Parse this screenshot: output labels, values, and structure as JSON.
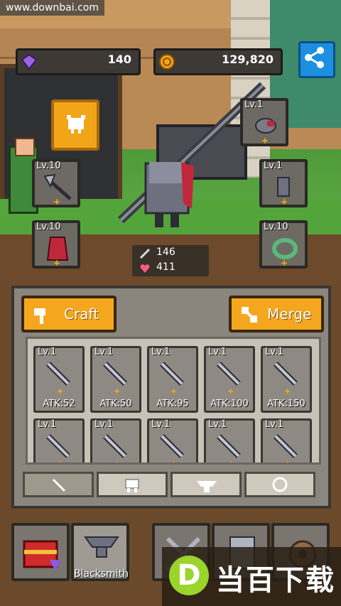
{
  "watermark": "www.downbai.com",
  "currency": {
    "gems": "140",
    "coins": "129,820",
    "gem_icon": "purple-gem-icon",
    "coin_icon": "gold-coin-icon",
    "share_icon": "share-icon"
  },
  "equipment": {
    "slots": [
      {
        "id": "helmet",
        "level": "Lv.1",
        "icon": "helmet-icon"
      },
      {
        "id": "weapon",
        "level": "Lv.10",
        "icon": "axe-icon"
      },
      {
        "id": "glove",
        "level": "Lv.1",
        "icon": "gauntlet-icon"
      },
      {
        "id": "armor",
        "level": "Lv.10",
        "icon": "armor-icon"
      },
      {
        "id": "ring",
        "level": "Lv.10",
        "icon": "ring-icon"
      }
    ],
    "pet_button_icon": "pet-icon"
  },
  "hero_stats": {
    "attack": "146",
    "health": "411",
    "attack_icon": "sword-icon",
    "health_icon": "heart-icon"
  },
  "panel": {
    "craft_label": "Craft",
    "merge_label": "Merge",
    "items": [
      {
        "level": "Lv.1",
        "atk": "ATK:52",
        "icon": "sword-icon"
      },
      {
        "level": "Lv.1",
        "atk": "ATK:50",
        "icon": "sword-icon"
      },
      {
        "level": "Lv.1",
        "atk": "ATK:95",
        "icon": "sword-icon"
      },
      {
        "level": "Lv.1",
        "atk": "ATK:100",
        "icon": "sword-icon"
      },
      {
        "level": "Lv.1",
        "atk": "ATK:150",
        "icon": "sword-icon"
      },
      {
        "level": "Lv.1",
        "atk": "",
        "icon": "sword-icon"
      },
      {
        "level": "Lv.1",
        "atk": "",
        "icon": "saw-sword-icon"
      },
      {
        "level": "Lv.1",
        "atk": "",
        "icon": "sword-icon"
      },
      {
        "level": "Lv.1",
        "atk": "",
        "icon": "spear-icon"
      },
      {
        "level": "Lv.1",
        "atk": "",
        "icon": "trident-icon"
      }
    ],
    "tabs": [
      {
        "icon": "sword-icon",
        "active": true
      },
      {
        "icon": "pet-icon",
        "active": false
      },
      {
        "icon": "anvil-icon",
        "active": false
      },
      {
        "icon": "ring-icon",
        "active": false
      }
    ]
  },
  "nav": {
    "items": [
      {
        "id": "chest",
        "label": "",
        "icon": "treasure-chest-icon",
        "active": false
      },
      {
        "id": "blacksmith",
        "label": "Blacksmith",
        "icon": "anvil-icon",
        "active": true
      },
      {
        "id": "battle",
        "label": "",
        "icon": "crossed-swords-icon",
        "active": false
      },
      {
        "id": "armory",
        "label": "",
        "icon": "armor-icon",
        "active": false
      },
      {
        "id": "more",
        "label": "",
        "icon": "gear-icon",
        "active": false
      }
    ]
  },
  "logo_text": "当百下载",
  "logo_letter": "D"
}
